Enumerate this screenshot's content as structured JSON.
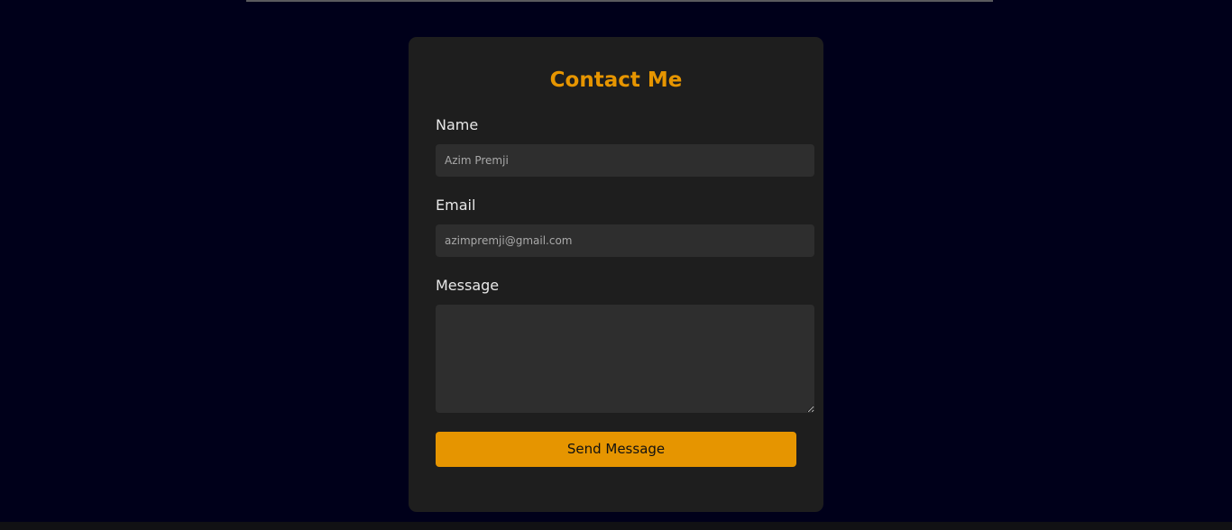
{
  "contact_form": {
    "title": "Contact Me",
    "name": {
      "label": "Name",
      "value": "",
      "placeholder": "Azim Premji"
    },
    "email": {
      "label": "Email",
      "value": "",
      "placeholder": "azimpremji@gmail.com"
    },
    "message": {
      "label": "Message",
      "value": "",
      "placeholder": ""
    },
    "submit_label": "Send Message"
  },
  "colors": {
    "page_background": "#00001a",
    "card_background": "#1e1e1e",
    "field_background": "#2e2e2e",
    "accent": "#e69500",
    "label_text": "#e8e8e8"
  }
}
